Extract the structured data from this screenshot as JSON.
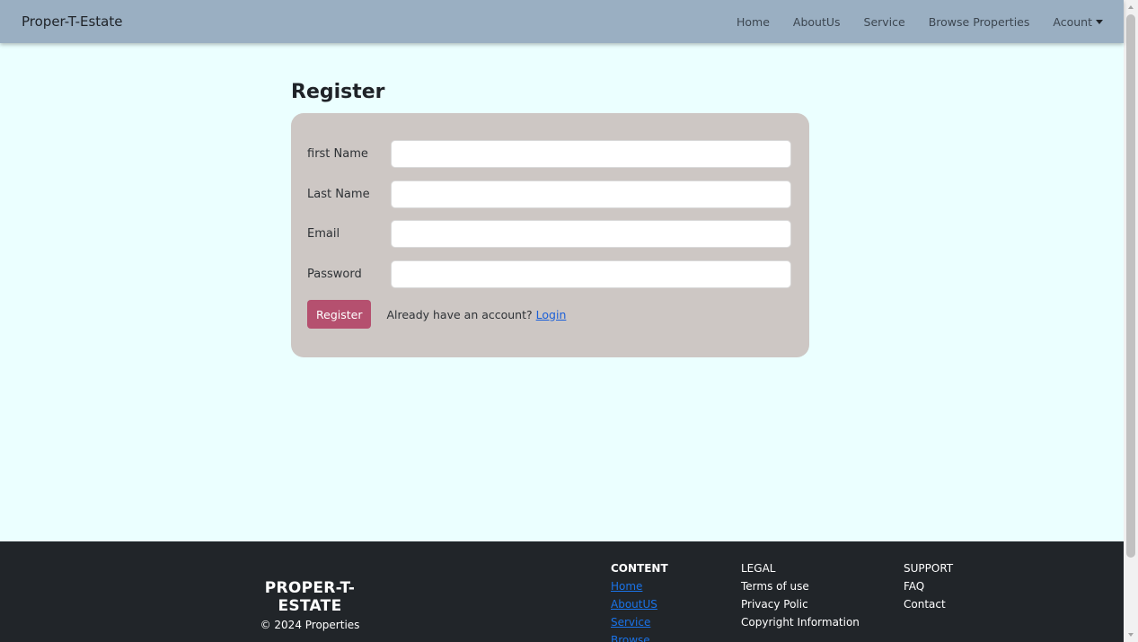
{
  "navbar": {
    "brand": "Proper-T-Estate",
    "links": [
      "Home",
      "AboutUs",
      "Service",
      "Browse Properties"
    ],
    "account": "Acount"
  },
  "page": {
    "title": "Register"
  },
  "form": {
    "fields": [
      {
        "label": "first Name",
        "value": ""
      },
      {
        "label": "Last Name",
        "value": ""
      },
      {
        "label": "Email",
        "value": ""
      },
      {
        "label": "Password",
        "value": ""
      }
    ],
    "submit_label": "Register",
    "already_text": "Already have an account?",
    "login_label": "Login"
  },
  "footer": {
    "brand": "PROPER-T-ESTATE",
    "copyright": "© 2024 Properties",
    "content": {
      "heading": "CONTENT",
      "links": [
        "Home",
        "AboutUS",
        "Service",
        "Browse"
      ]
    },
    "legal": {
      "heading": "LEGAL",
      "items": [
        "Terms of use",
        "Privacy Polic",
        "Copyright Information"
      ]
    },
    "support": {
      "heading": "SUPPORT",
      "items": [
        "FAQ",
        "Contact"
      ]
    }
  },
  "colors": {
    "navbar_bg": "#9aafc2",
    "page_bg": "#ebffff",
    "card_bg": "#cdc7c4",
    "button_bg": "#b5506f",
    "footer_bg": "#212529",
    "link": "#1a5fd8"
  }
}
